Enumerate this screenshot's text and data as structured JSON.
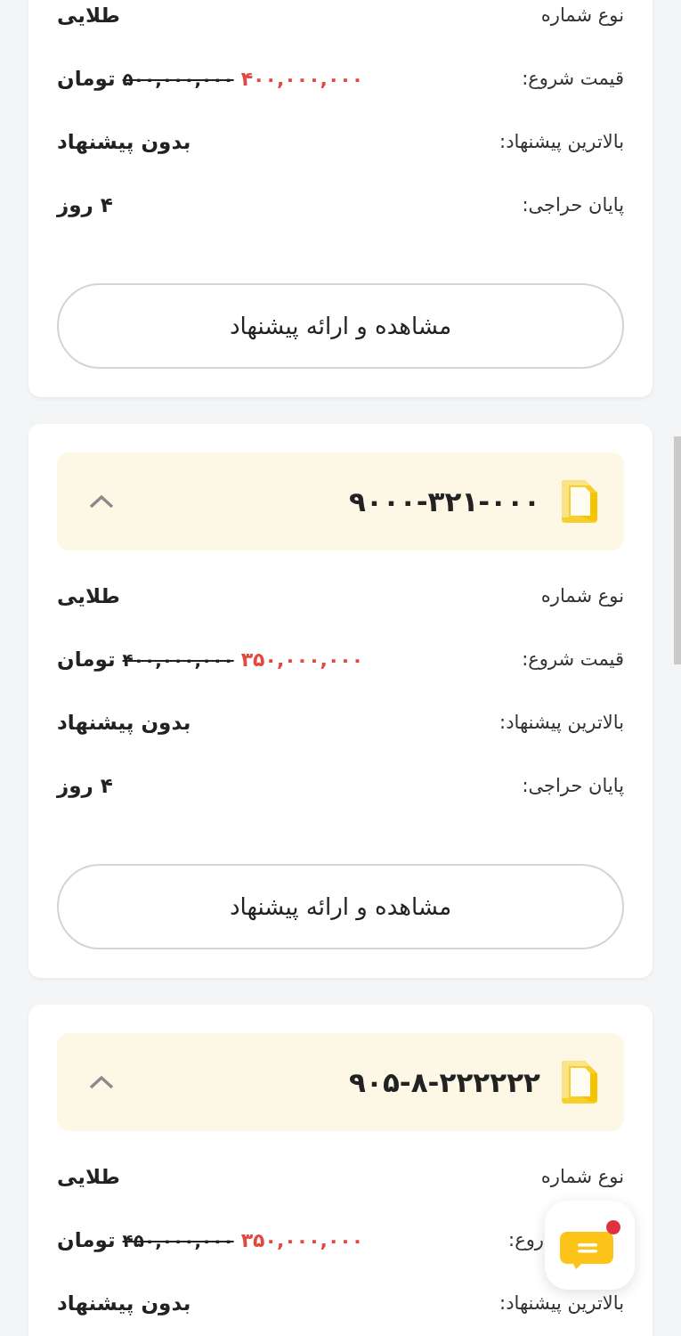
{
  "cards": [
    {
      "rows": [
        {
          "kind": "text",
          "label": "نوع شماره",
          "value": "طلایی"
        },
        {
          "kind": "price",
          "label": "قیمت شروع:",
          "new_price": "۴۰۰,۰۰۰,۰۰۰",
          "old_price": "۵۰۰,۰۰۰,۰۰۰",
          "currency": "تومان"
        },
        {
          "kind": "text",
          "label": "بالاترین پیشنهاد:",
          "value": "بدون پیشنهاد"
        },
        {
          "kind": "text",
          "label": "پایان حراجی:",
          "value": "۴ روز"
        }
      ],
      "button": "مشاهده و ارائه پیشنهاد"
    },
    {
      "number": "۹۰۰۰-۳۲۱-۰۰۰",
      "expanded": true,
      "rows": [
        {
          "kind": "text",
          "label": "نوع شماره",
          "value": "طلایی"
        },
        {
          "kind": "price",
          "label": "قیمت شروع:",
          "new_price": "۳۵۰,۰۰۰,۰۰۰",
          "old_price": "۴۰۰,۰۰۰,۰۰۰",
          "currency": "تومان"
        },
        {
          "kind": "text",
          "label": "بالاترین پیشنهاد:",
          "value": "بدون پیشنهاد"
        },
        {
          "kind": "text",
          "label": "پایان حراجی:",
          "value": "۴ روز"
        }
      ],
      "button": "مشاهده و ارائه پیشنهاد"
    },
    {
      "number": "۹۰۵-۸-۲۲۲۲۲۲",
      "expanded": true,
      "rows": [
        {
          "kind": "text",
          "label": "نوع شماره",
          "value": "طلایی"
        },
        {
          "kind": "price",
          "label": "روع:",
          "partly_hidden": true,
          "new_price": "۳۵۰,۰۰۰,۰۰۰",
          "old_price": "۴۵۰,۰۰۰,۰۰۰",
          "currency": "تومان"
        },
        {
          "kind": "text",
          "label": "بالاترین پیشنهاد:",
          "value": "بدون پیشنهاد"
        }
      ]
    }
  ],
  "chat_button": {
    "unread": true
  }
}
